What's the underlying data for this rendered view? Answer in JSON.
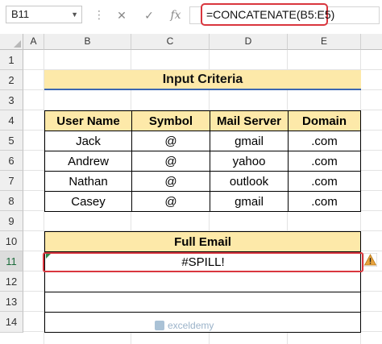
{
  "formula_bar": {
    "name_box": "B11",
    "cancel_glyph": "✕",
    "enter_glyph": "✓",
    "fx_label": "fx",
    "formula": "=CONCATENATE(B5:E5)"
  },
  "columns": [
    "A",
    "B",
    "C",
    "D",
    "E"
  ],
  "rows": [
    "1",
    "2",
    "3",
    "4",
    "5",
    "6",
    "7",
    "8",
    "9",
    "10",
    "11",
    "12",
    "13",
    "14"
  ],
  "active_row": "11",
  "title": "Input Criteria",
  "table": {
    "headers": [
      "User Name",
      "Symbol",
      "Mail Server",
      "Domain"
    ],
    "rows": [
      [
        "Jack",
        "@",
        "gmail",
        ".com"
      ],
      [
        "Andrew",
        "@",
        "yahoo",
        ".com"
      ],
      [
        "Nathan",
        "@",
        "outlook",
        ".com"
      ],
      [
        "Casey",
        "@",
        "gmail",
        ".com"
      ]
    ]
  },
  "full_email": {
    "header": "Full Email",
    "value": "#SPILL!"
  },
  "watermark": "exceldemy",
  "colors": {
    "header_fill": "#fde9a9",
    "highlight_red": "#d9363e",
    "title_underline": "#3c67b1",
    "warning_orange": "#e8a33c"
  },
  "icons": [
    "dropdown-arrow-icon",
    "cancel-icon",
    "enter-icon",
    "function-icon",
    "warning-icon",
    "select-all-icon",
    "watermark-logo-icon"
  ]
}
